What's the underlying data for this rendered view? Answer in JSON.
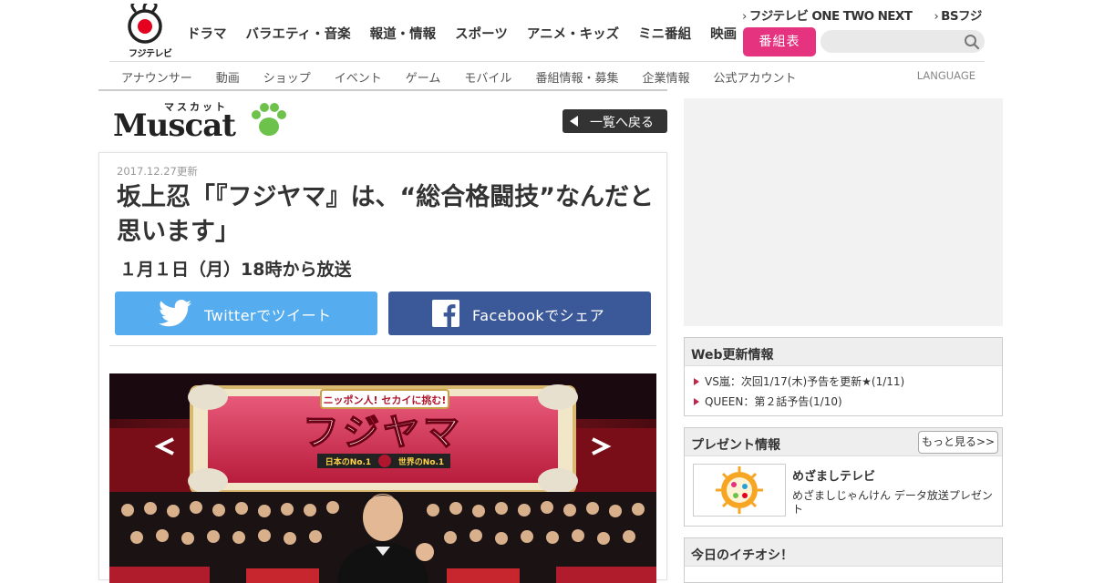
{
  "header": {
    "logo_text": "フジテレビ",
    "main_nav": [
      "ドラマ",
      "バラエティ・音楽",
      "報道・情報",
      "スポーツ",
      "アニメ・キッズ",
      "ミニ番組",
      "映画"
    ],
    "ext_links": [
      "フジテレビ ONE TWO NEXT",
      "BSフジ"
    ],
    "program_button": "番組表",
    "search_placeholder": "",
    "sub_nav": [
      "アナウンサー",
      "動画",
      "ショップ",
      "イベント",
      "ゲーム",
      "モバイル",
      "番組情報・募集",
      "企業情報",
      "公式アカウント"
    ],
    "language": "LANGUAGE"
  },
  "section": {
    "kana": "マスカット",
    "name": "Muscat",
    "back_label": "一覧へ戻る"
  },
  "article": {
    "date": "2017.12.27更新",
    "title": "坂上忍「『フジヤマ』は、“総合格闘技”なんだと思います」",
    "subtitle": "１月１日（月）18時から放送",
    "twitter_label": "Twitterでツイート",
    "facebook_label": "Facebookでシェア",
    "photo": {
      "top_label": "ニッポン人! セカイに挑む!",
      "logo_text": "フジヤマ",
      "banner_left": "日本のNo.1",
      "banner_right": "世界のNo.1"
    }
  },
  "sidebar": {
    "web_updates": {
      "title": "Web更新情報",
      "items": [
        "VS嵐：次回1/17(木)予告を更新★(1/11)",
        "QUEEN：第２話予告(1/10)"
      ]
    },
    "present": {
      "title": "プレゼント情報",
      "more_label": "もっと見る>>",
      "item_name": "めざましテレビ",
      "item_desc": "めざましじゃんけん データ放送プレゼント"
    },
    "ichioshi": {
      "title": "今日のイチオシ！"
    }
  },
  "colors": {
    "pink": "#e6337f",
    "twitter": "#55acee",
    "facebook": "#3b5998",
    "paw_green": "#6cc24a",
    "bullet_red": "#c0264a"
  }
}
